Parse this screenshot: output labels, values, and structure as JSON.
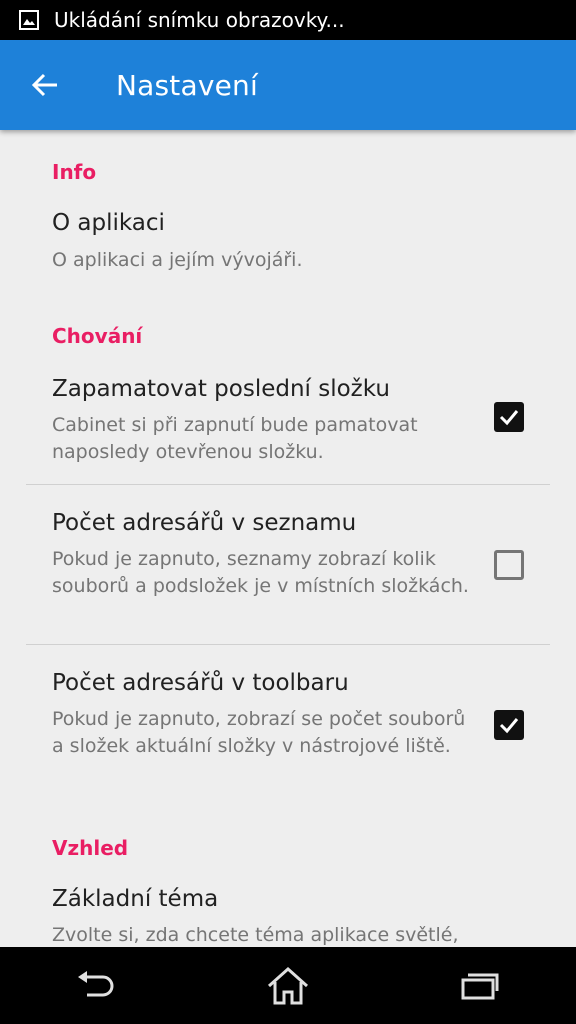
{
  "status_bar": {
    "notification_text": "Ukládání snímku obrazovky...",
    "icon": "image-icon"
  },
  "app_bar": {
    "title": "Nastavení",
    "back_icon": "arrow-back-icon",
    "color": "#1e81d9"
  },
  "sections": [
    {
      "header": "Info",
      "items": [
        {
          "title": "O aplikaci",
          "summary": "O aplikaci a jejím vývojáři."
        }
      ]
    },
    {
      "header": "Chování",
      "items": [
        {
          "title": "Zapamatovat poslední složku",
          "summary": "Cabinet si při zapnutí bude pamatovat naposledy otevřenou složku.",
          "checked": true
        },
        {
          "title": "Počet adresářů v seznamu",
          "summary": "Pokud je zapnuto, seznamy zobrazí kolik souborů a podsložek je v místních složkách.",
          "checked": false
        },
        {
          "title": "Počet adresářů v toolbaru",
          "summary": "Pokud je zapnuto, zobrazí se počet souborů a složek aktuální složky v nástrojové liště.",
          "checked": true
        }
      ]
    },
    {
      "header": "Vzhled",
      "items": [
        {
          "title": "Základní téma",
          "summary": "Zvolte si, zda chcete téma aplikace světlé,"
        }
      ]
    }
  ],
  "accent_color": "#e91e63",
  "nav_bar": {
    "back": "back-icon",
    "home": "home-icon",
    "recents": "recents-icon"
  }
}
